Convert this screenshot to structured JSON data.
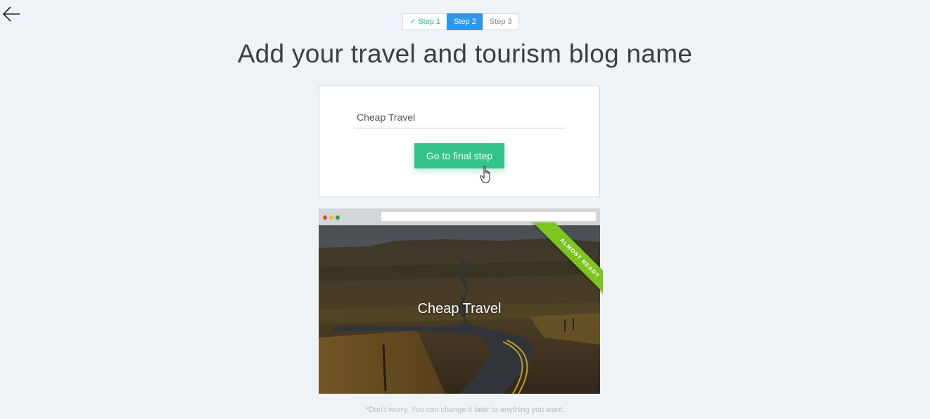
{
  "navigation": {
    "back_icon": "arrow-left-icon"
  },
  "steps": [
    {
      "label": "Step 1",
      "state": "done",
      "icon": "checkmark-icon"
    },
    {
      "label": "Step 2",
      "state": "active"
    },
    {
      "label": "Step 3",
      "state": "upcoming"
    }
  ],
  "page": {
    "title": "Add your travel and tourism blog name"
  },
  "form": {
    "blog_name_value": "Cheap Travel",
    "submit_label": "Go to final step"
  },
  "preview": {
    "blog_title": "Cheap Travel",
    "ribbon_label": "ALMOST READY"
  },
  "footer": {
    "note": "*Don't worry. You can change it later to anything you want."
  },
  "colors": {
    "accent_green": "#34c38a",
    "active_step_blue": "#2f97e9",
    "ribbon_green": "#7cc520",
    "background": "#edf3f7"
  }
}
